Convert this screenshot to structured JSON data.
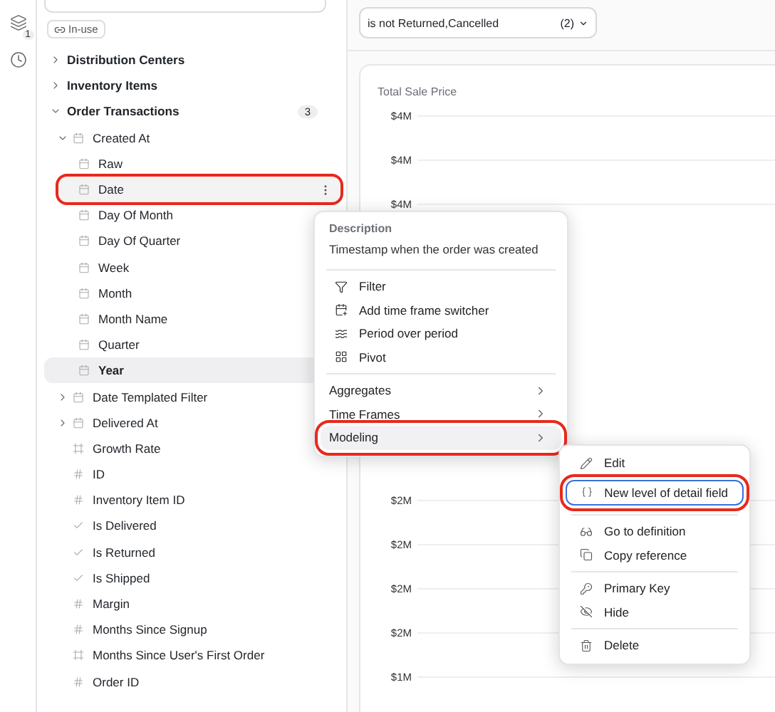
{
  "rail": {
    "layers_badge": "1"
  },
  "sidebar": {
    "chip": "In-use",
    "tree": [
      {
        "label": "Distribution Centers",
        "kind": "group",
        "expanded": false
      },
      {
        "label": "Inventory Items",
        "kind": "group",
        "expanded": false
      },
      {
        "label": "Order Transactions",
        "kind": "group",
        "expanded": true,
        "count": "3",
        "children": [
          {
            "label": "Created At",
            "kind": "date_group",
            "expanded": true,
            "children": [
              {
                "label": "Raw",
                "kind": "date",
                "selected": false,
                "menu_open": false
              },
              {
                "label": "Date",
                "kind": "date",
                "selected": false,
                "menu_open": true,
                "annotated": true
              },
              {
                "label": "Day Of Month",
                "kind": "date",
                "selected": false,
                "menu_open": false
              },
              {
                "label": "Day Of Quarter",
                "kind": "date",
                "selected": false,
                "menu_open": false
              },
              {
                "label": "Week",
                "kind": "date",
                "selected": false,
                "menu_open": false
              },
              {
                "label": "Month",
                "kind": "date",
                "selected": false,
                "menu_open": false
              },
              {
                "label": "Month Name",
                "kind": "date",
                "selected": false,
                "menu_open": false
              },
              {
                "label": "Quarter",
                "kind": "date",
                "selected": false,
                "menu_open": false
              },
              {
                "label": "Year",
                "kind": "date",
                "selected": true,
                "menu_open": false
              }
            ]
          },
          {
            "label": "Date Templated Filter",
            "kind": "date_group",
            "expanded": false
          },
          {
            "label": "Delivered At",
            "kind": "date_group",
            "expanded": false
          },
          {
            "label": "Growth Rate",
            "kind": "custom"
          },
          {
            "label": "ID",
            "kind": "number"
          },
          {
            "label": "Inventory Item ID",
            "kind": "number"
          },
          {
            "label": "Is Delivered",
            "kind": "yesno"
          },
          {
            "label": "Is Returned",
            "kind": "yesno"
          },
          {
            "label": "Is Shipped",
            "kind": "yesno"
          },
          {
            "label": "Margin",
            "kind": "number"
          },
          {
            "label": "Months Since Signup",
            "kind": "number"
          },
          {
            "label": "Months Since User's First Order",
            "kind": "custom"
          },
          {
            "label": "Order ID",
            "kind": "number"
          }
        ]
      }
    ]
  },
  "filter": {
    "value": "is not Returned,Cancelled",
    "count": "(2)"
  },
  "chart": {
    "title": "Total Sale Price",
    "top_labels": [
      "$4M",
      "$4M",
      "$4M"
    ],
    "bottom_labels": [
      "$2M",
      "$2M",
      "$2M",
      "$2M",
      "$1M"
    ]
  },
  "menu": {
    "description_label": "Description",
    "description": "Timestamp when the order was created",
    "actions": [
      {
        "label": "Filter"
      },
      {
        "label": "Add time frame switcher"
      },
      {
        "label": "Period over period"
      },
      {
        "label": "Pivot"
      }
    ],
    "submenus": [
      {
        "label": "Aggregates",
        "selected": false,
        "annotated": false
      },
      {
        "label": "Time Frames",
        "selected": false,
        "annotated": false
      },
      {
        "label": "Modeling",
        "selected": true,
        "annotated": true
      }
    ]
  },
  "submenu": {
    "sections": [
      [
        {
          "label": "Edit",
          "focused": false,
          "annotated": false
        },
        {
          "label": "New level of detail field",
          "focused": true,
          "annotated": true
        }
      ],
      [
        {
          "label": "Go to definition",
          "focused": false,
          "annotated": false
        },
        {
          "label": "Copy reference",
          "focused": false,
          "annotated": false
        }
      ],
      [
        {
          "label": "Primary Key",
          "focused": false,
          "annotated": false
        },
        {
          "label": "Hide",
          "focused": false,
          "annotated": false
        }
      ],
      [
        {
          "label": "Delete",
          "focused": false,
          "annotated": false
        }
      ]
    ]
  }
}
